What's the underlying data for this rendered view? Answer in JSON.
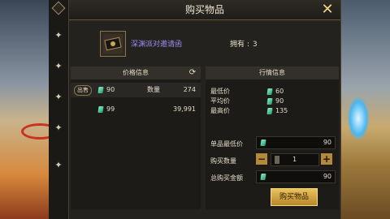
{
  "dialog": {
    "title": "购买物品",
    "close_icon": "close-x-icon"
  },
  "item": {
    "name": "深渊派对邀请函",
    "owned_label": "拥有 :",
    "owned_count": "3"
  },
  "price_info": {
    "header": "价格信息",
    "refresh_icon": "refresh-icon",
    "sell_tag": "出售",
    "quantity_label": "数量",
    "rows": [
      {
        "price": "90",
        "quantity": "274"
      },
      {
        "price": "99",
        "quantity": "39,991"
      }
    ]
  },
  "market_info": {
    "header": "行情信息",
    "rows": [
      {
        "label": "最低价",
        "value": "60"
      },
      {
        "label": "平均价",
        "value": "90"
      },
      {
        "label": "最高价",
        "value": "135"
      }
    ]
  },
  "purchase": {
    "unit_min_label": "单品最低价",
    "unit_min_value": "90",
    "qty_label": "购买数量",
    "qty_value": "1",
    "minus": "−",
    "plus": "+",
    "total_label": "总购买金额",
    "total_value": "90",
    "buy_button": "购买物品"
  },
  "colors": {
    "gem": "#3fd29a",
    "accent_gold": "#d9aa45",
    "item_name": "#9d8ff0"
  }
}
